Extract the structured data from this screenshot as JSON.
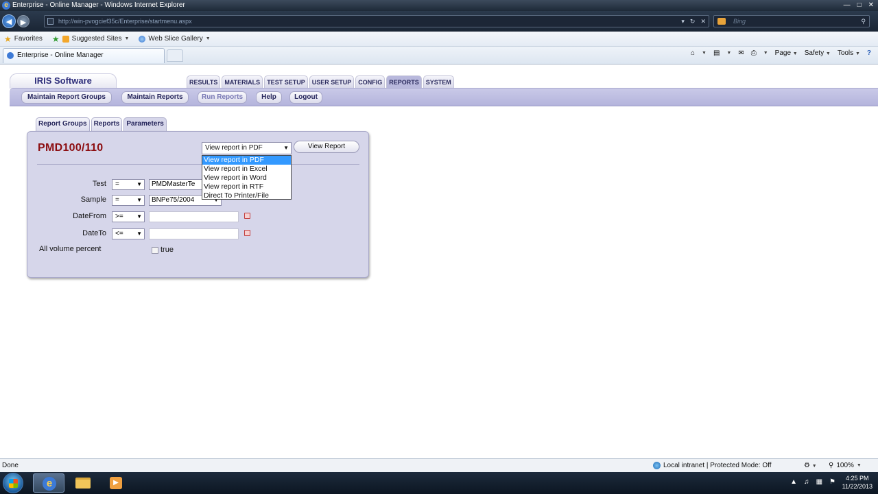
{
  "window": {
    "title": "Enterprise - Online Manager - Windows Internet Explorer"
  },
  "addressbar": {
    "url": "http://win-pvogcief35c/Enterprise/startmenu.aspx",
    "search_placeholder": "Bing"
  },
  "favorites_bar": {
    "favorites_label": "Favorites",
    "suggested_label": "Suggested Sites",
    "webslice_label": "Web Slice Gallery"
  },
  "command_bar": {
    "tab_title": "Enterprise - Online Manager",
    "page_label": "Page",
    "safety_label": "Safety",
    "tools_label": "Tools"
  },
  "app": {
    "brand": "IRIS Software",
    "main_tabs": [
      "RESULTS",
      "MATERIALS",
      "TEST SETUP",
      "USER SETUP",
      "CONFIG",
      "REPORTS",
      "SYSTEM"
    ],
    "active_main_tab": "REPORTS",
    "sub_buttons": [
      "Maintain Report Groups",
      "Maintain Reports",
      "Run Reports",
      "Help",
      "Logout"
    ],
    "active_sub_button": "Run Reports",
    "panel_tabs": [
      "Report Groups",
      "Reports",
      "Parameters"
    ],
    "active_panel_tab": "Parameters"
  },
  "report": {
    "title": "PMD100/110",
    "view_select_value": "View report in PDF",
    "view_button": "View Report",
    "view_options": [
      "View report in PDF",
      "View report in Excel",
      "View report in Word",
      "View report in RTF",
      "Direct To Printer/File"
    ],
    "selected_option": "View report in PDF",
    "params": {
      "test": {
        "label": "Test",
        "op": "=",
        "value": "PMDMasterTe"
      },
      "sample": {
        "label": "Sample",
        "op": "=",
        "value": "BNPe75/2004"
      },
      "datefrom": {
        "label": "DateFrom",
        "op": ">=",
        "value": ""
      },
      "dateto": {
        "label": "DateTo",
        "op": "<=",
        "value": ""
      },
      "allvol": {
        "label": "All volume percent",
        "checkbox_label": "true"
      }
    }
  },
  "statusbar": {
    "status": "Done",
    "zone": "Local intranet | Protected Mode: Off",
    "zoom": "100%"
  },
  "taskbar": {
    "time": "4:25 PM",
    "date": "11/22/2013"
  }
}
